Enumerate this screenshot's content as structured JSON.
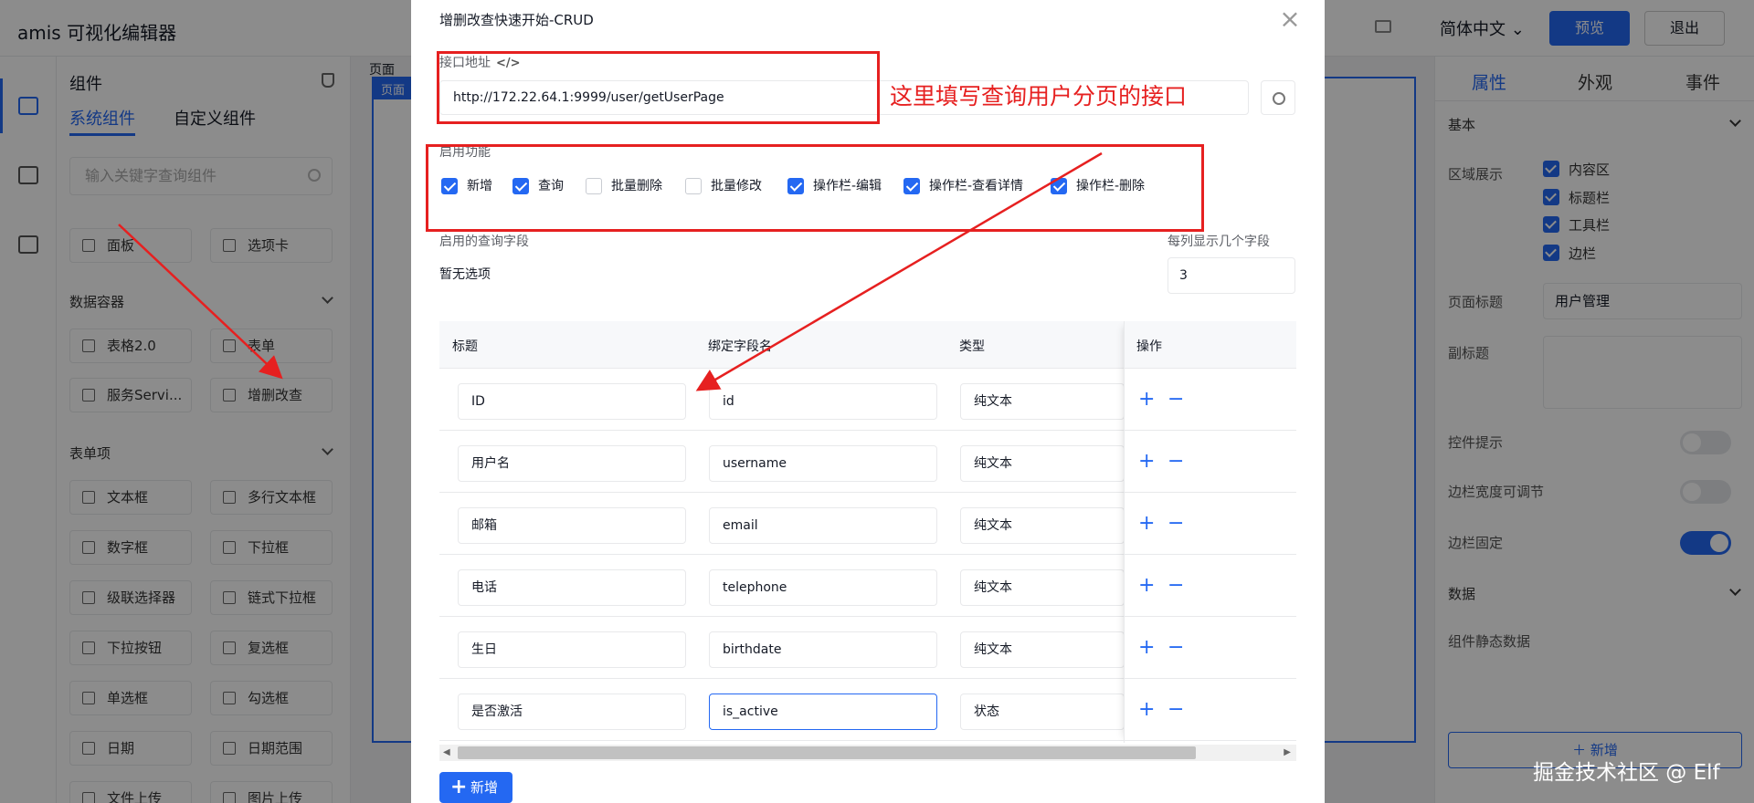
{
  "app": {
    "title": "amis 可视化编辑器",
    "lang": "简体中文",
    "preview": "预览",
    "exit": "退出"
  },
  "left_panel": {
    "title": "组件",
    "tabs": [
      "系统组件",
      "自定义组件"
    ],
    "search_placeholder": "输入关键字查询组件",
    "sections": [
      {
        "name": "",
        "items": [
          "面板",
          "选项卡"
        ]
      },
      {
        "name": "数据容器",
        "items": [
          "表格2.0",
          "表单",
          "服务Servi...",
          "增删改查"
        ]
      },
      {
        "name": "表单项",
        "items": [
          "文本框",
          "多行文本框",
          "数字框",
          "下拉框",
          "级联选择器",
          "链式下拉框",
          "下拉按钮",
          "复选框",
          "单选框",
          "勾选框",
          "日期",
          "日期范围",
          "文件上传",
          "图片上传"
        ]
      }
    ]
  },
  "canvas": {
    "tab": "页面",
    "tag": "页面"
  },
  "right_panel": {
    "tabs": [
      "属性",
      "外观",
      "事件"
    ],
    "basic": "基本",
    "area_label": "区域展示",
    "area_items": [
      "内容区",
      "标题栏",
      "工具栏",
      "边栏"
    ],
    "page_title_label": "页面标题",
    "page_title_value": "用户管理",
    "subtitle_label": "副标题",
    "switches": [
      {
        "label": "控件提示",
        "on": false
      },
      {
        "label": "边栏宽度可调节",
        "on": false
      },
      {
        "label": "边栏固定",
        "on": true
      }
    ],
    "data_section": "数据",
    "static_data_label": "组件静态数据",
    "new_button": "＋ 新增"
  },
  "dialog": {
    "title": "增删改查快速开始-CRUD",
    "api_label": "接口地址",
    "api_icon": "</>",
    "api_value": "http://172.22.64.1:9999/user/getUserPage",
    "features_label": "启用功能",
    "features": [
      {
        "label": "新增",
        "checked": true
      },
      {
        "label": "查询",
        "checked": true
      },
      {
        "label": "批量删除",
        "checked": false
      },
      {
        "label": "批量修改",
        "checked": false
      },
      {
        "label": "操作栏-编辑",
        "checked": true
      },
      {
        "label": "操作栏-查看详情",
        "checked": true
      },
      {
        "label": "操作栏-删除",
        "checked": true
      }
    ],
    "query_fields_label": "启用的查询字段",
    "query_fields_empty": "暂无选项",
    "per_col_label": "每列显示几个字段",
    "per_col_value": "3",
    "table": {
      "headers": [
        "标题",
        "绑定字段名",
        "类型",
        "操作"
      ],
      "rows": [
        {
          "title": "ID",
          "field": "id",
          "type": "纯文本"
        },
        {
          "title": "用户名",
          "field": "username",
          "type": "纯文本"
        },
        {
          "title": "邮箱",
          "field": "email",
          "type": "纯文本"
        },
        {
          "title": "电话",
          "field": "telephone",
          "type": "纯文本"
        },
        {
          "title": "生日",
          "field": "birthdate",
          "type": "纯文本"
        },
        {
          "title": "是否激活",
          "field": "is_active",
          "type": "状态"
        }
      ],
      "op_add": "+",
      "op_remove": "−"
    },
    "add_button": "新增"
  },
  "annotation": {
    "text": "这里填写查询用户分页的接口",
    "color": "#e62020"
  },
  "watermark": "掘金技术社区 @ Elf",
  "colors": {
    "primary": "#2468f2",
    "annotation": "#e62020"
  }
}
